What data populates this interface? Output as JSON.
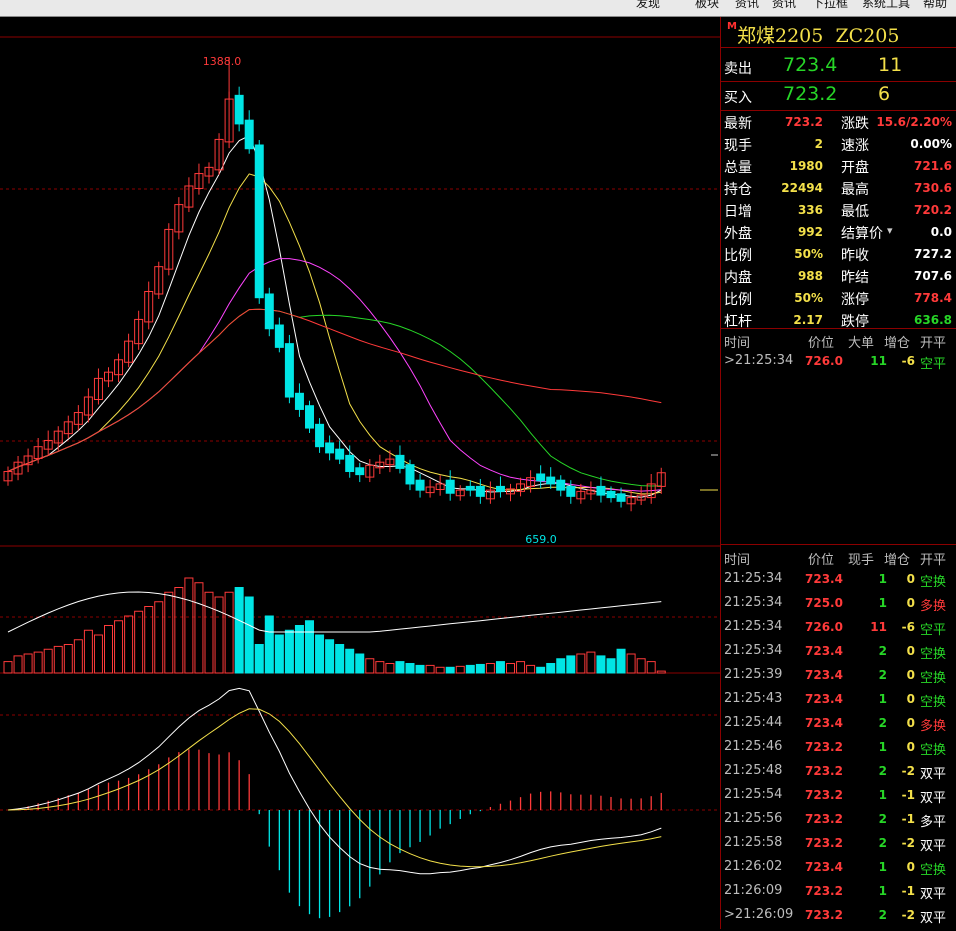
{
  "menu": [
    "发现",
    "板块",
    "资讯",
    "资讯",
    "下拉框",
    "系统工具",
    "帮助"
  ],
  "instrument": {
    "marker": "M",
    "name": "郑煤2205",
    "code": "ZC205"
  },
  "order_book": {
    "ask": {
      "label": "卖出",
      "price": "723.4",
      "volume": "11"
    },
    "bid": {
      "label": "买入",
      "price": "723.2",
      "volume": "6"
    }
  },
  "stats": [
    {
      "label": "最新",
      "value": "723.2",
      "label2": "涨跌",
      "value2": "15.6/2.20%"
    },
    {
      "label": "现手",
      "value": "2",
      "label2": "速涨",
      "value2": "0.00%"
    },
    {
      "label": "总量",
      "value": "1980",
      "label2": "开盘",
      "value2": "721.6"
    },
    {
      "label": "持仓",
      "value": "22494",
      "label2": "最高",
      "value2": "730.6"
    },
    {
      "label": "日增",
      "value": "336",
      "label2": "最低",
      "value2": "720.2"
    },
    {
      "label": "外盘",
      "value": "992",
      "label2": "结算价",
      "value2": "0.0"
    },
    {
      "label": "比例",
      "value": "50%",
      "label2": "昨收",
      "value2": "727.2"
    },
    {
      "label": "内盘",
      "value": "988",
      "label2": "昨结",
      "value2": "707.6"
    },
    {
      "label": "比例",
      "value": "50%",
      "label2": "涨停",
      "value2": "778.4"
    },
    {
      "label": "杠杆",
      "value": "2.17",
      "label2": "跌停",
      "value2": "636.8"
    }
  ],
  "big_orders": {
    "headers": [
      "时间",
      "价位",
      "大单",
      "增仓",
      "开平"
    ],
    "rows": [
      {
        "time": ">21:25:34",
        "price": "726.0",
        "size": "11",
        "change": "-6",
        "type": "空平"
      }
    ]
  },
  "ticks": {
    "headers": [
      "时间",
      "价位",
      "现手",
      "增仓",
      "开平"
    ],
    "rows": [
      {
        "time": "21:25:34",
        "price": "723.4",
        "qty": "1",
        "chg": "0",
        "type": "空换"
      },
      {
        "time": "21:25:34",
        "price": "725.0",
        "qty": "1",
        "chg": "0",
        "type": "多换"
      },
      {
        "time": "21:25:34",
        "price": "726.0",
        "qty": "11",
        "chg": "-6",
        "type": "空平"
      },
      {
        "time": "21:25:34",
        "price": "723.4",
        "qty": "2",
        "chg": "0",
        "type": "空换"
      },
      {
        "time": "21:25:39",
        "price": "723.4",
        "qty": "2",
        "chg": "0",
        "type": "空换"
      },
      {
        "time": "21:25:43",
        "price": "723.4",
        "qty": "1",
        "chg": "0",
        "type": "空换"
      },
      {
        "time": "21:25:44",
        "price": "723.4",
        "qty": "2",
        "chg": "0",
        "type": "多换"
      },
      {
        "time": "21:25:46",
        "price": "723.2",
        "qty": "1",
        "chg": "0",
        "type": "空换"
      },
      {
        "time": "21:25:48",
        "price": "723.2",
        "qty": "2",
        "chg": "-2",
        "type": "双平"
      },
      {
        "time": "21:25:54",
        "price": "723.2",
        "qty": "1",
        "chg": "-1",
        "type": "双平"
      },
      {
        "time": "21:25:56",
        "price": "723.2",
        "qty": "2",
        "chg": "-1",
        "type": "多平"
      },
      {
        "time": "21:25:58",
        "price": "723.2",
        "qty": "2",
        "chg": "-2",
        "type": "双平"
      },
      {
        "time": "21:26:02",
        "price": "723.4",
        "qty": "1",
        "chg": "0",
        "type": "空换"
      },
      {
        "time": "21:26:09",
        "price": "723.2",
        "qty": "1",
        "chg": "-1",
        "type": "双平"
      },
      {
        "time": ">21:26:09",
        "price": "723.2",
        "qty": "2",
        "chg": "-2",
        "type": "双平"
      }
    ]
  },
  "chart_data": {
    "type": "candlestick",
    "annotations": {
      "high_label": "1388.0",
      "low_label": "659.0"
    },
    "colors": {
      "up": "#ff3a3a",
      "down": "#00e5e5",
      "ma5": "#ffffff",
      "ma10": "#f3e04a",
      "ma20": "#ff44ff",
      "ma40": "#27d627",
      "ma60": "#ff3a3a"
    }
  }
}
